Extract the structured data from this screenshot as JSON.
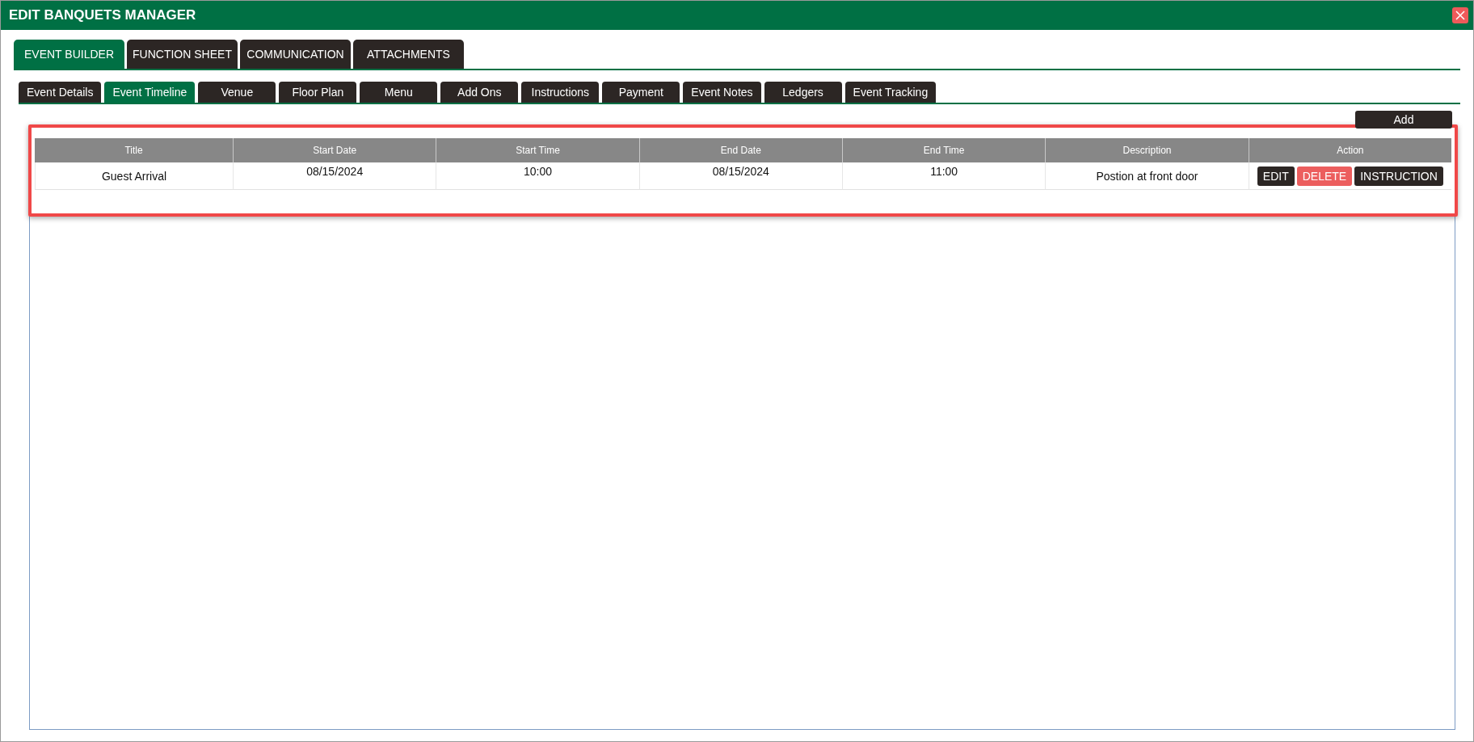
{
  "window": {
    "title": "EDIT BANQUETS MANAGER"
  },
  "main_tabs": [
    {
      "label": "EVENT BUILDER",
      "selected": true
    },
    {
      "label": "FUNCTION SHEET",
      "selected": false
    },
    {
      "label": "COMMUNICATION",
      "selected": false
    },
    {
      "label": "ATTACHMENTS",
      "selected": false
    }
  ],
  "sub_tabs": [
    {
      "label": "Event Details",
      "selected": false
    },
    {
      "label": "Event Timeline",
      "selected": true
    },
    {
      "label": "Venue",
      "selected": false
    },
    {
      "label": "Floor Plan",
      "selected": false
    },
    {
      "label": "Menu",
      "selected": false
    },
    {
      "label": "Add Ons",
      "selected": false
    },
    {
      "label": "Instructions",
      "selected": false
    },
    {
      "label": "Payment",
      "selected": false
    },
    {
      "label": "Event Notes",
      "selected": false
    },
    {
      "label": "Ledgers",
      "selected": false
    },
    {
      "label": "Event Tracking",
      "selected": false
    }
  ],
  "add_button": "Add",
  "table": {
    "columns": [
      "Title",
      "Start Date",
      "Start Time",
      "End Date",
      "End Time",
      "Description",
      "Action"
    ],
    "rows": [
      {
        "cells": [
          "Guest Arrival",
          "08/15/2024",
          "10:00",
          "08/15/2024",
          "11:00",
          "Postion at front door"
        ],
        "actions": [
          {
            "label": "EDIT",
            "kind": "dark"
          },
          {
            "label": "DELETE",
            "kind": "danger"
          },
          {
            "label": "INSTRUCTION",
            "kind": "dark"
          }
        ]
      }
    ]
  },
  "highlight": {
    "color": "#f04848"
  }
}
